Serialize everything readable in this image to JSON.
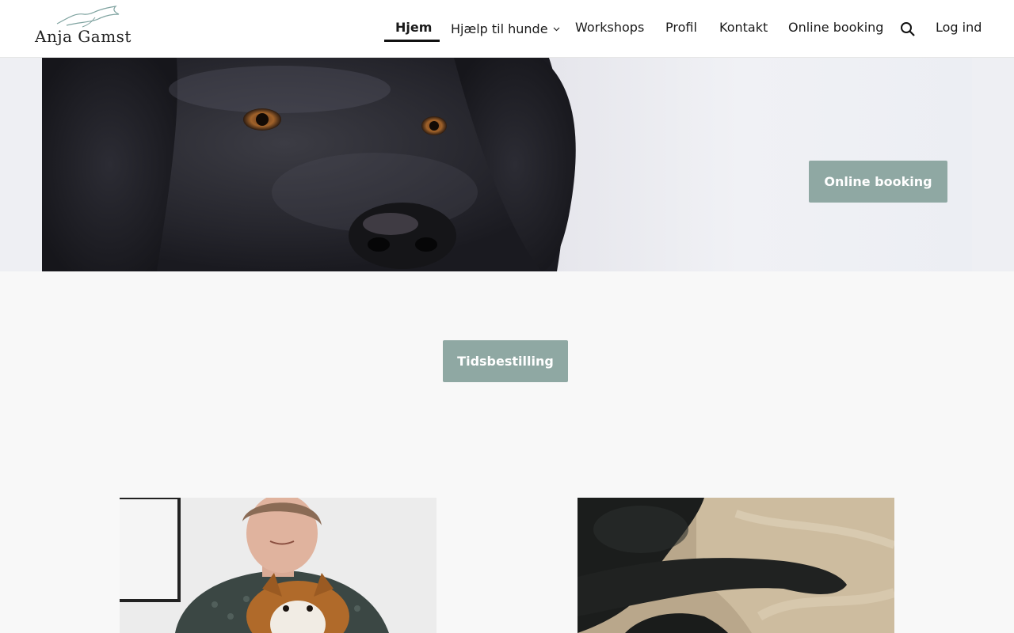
{
  "brand": {
    "name": "Anja Gamst"
  },
  "nav": {
    "items": [
      {
        "label": "Hjem",
        "active": true
      },
      {
        "label": "Hjælp til hunde",
        "has_dropdown": true
      },
      {
        "label": "Workshops"
      },
      {
        "label": "Profil"
      },
      {
        "label": "Kontakt"
      },
      {
        "label": "Online booking"
      }
    ],
    "search_icon": "search-icon",
    "login_label": "Log ind"
  },
  "hero": {
    "image": "black-labrador-face",
    "button_label": "Online booking"
  },
  "booking": {
    "button_label": "Tidsbestilling"
  },
  "photos": [
    {
      "image": "woman-with-sheltie"
    },
    {
      "image": "black-dog-on-blanket"
    }
  ],
  "colors": {
    "button": "#8fa8a3",
    "header": "#ffffff",
    "page": "#f8f8f8"
  }
}
